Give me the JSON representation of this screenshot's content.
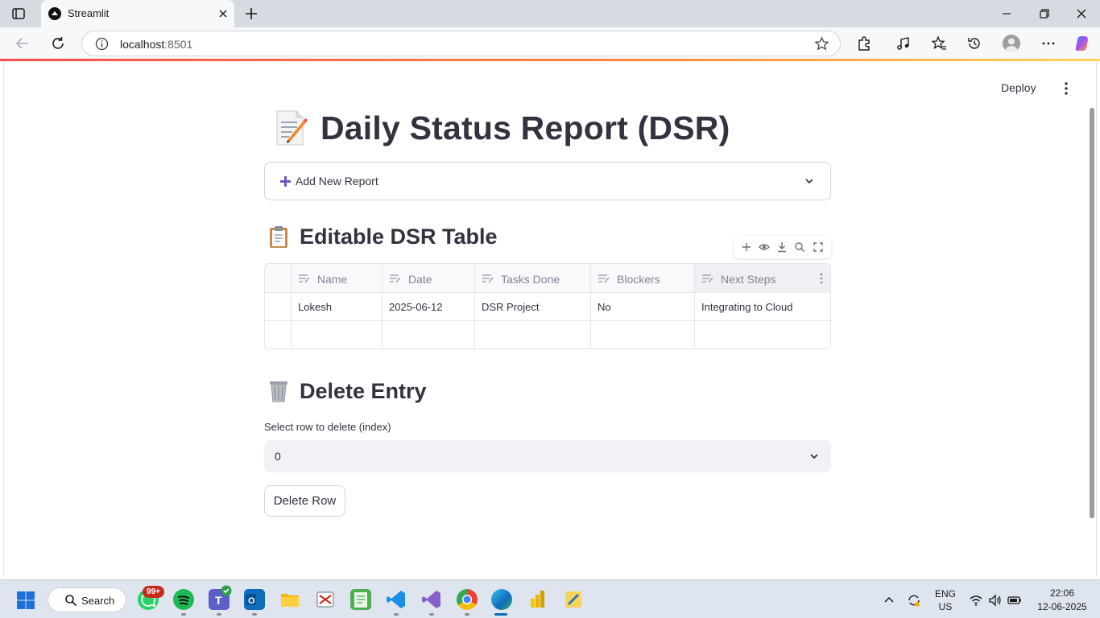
{
  "browser": {
    "tab_title": "Streamlit",
    "url_host": "localhost",
    "url_port": ":8501"
  },
  "app": {
    "deploy_label": "Deploy",
    "title": "Daily Status Report (DSR)",
    "title_emoji": "memo-icon",
    "expander_label": "Add New Report",
    "table_heading": "Editable DSR Table",
    "table_heading_emoji": "clipboard-icon",
    "table": {
      "columns": [
        "Name",
        "Date",
        "Tasks Done",
        "Blockers",
        "Next Steps"
      ],
      "rows": [
        [
          "Lokesh",
          "2025-06-12",
          "DSR Project",
          "No",
          "Integrating to Cloud"
        ],
        [
          "",
          "",
          "",
          "",
          ""
        ]
      ]
    },
    "delete_heading": "Delete Entry",
    "delete_heading_emoji": "wastebasket-icon",
    "select_label": "Select row to delete (index)",
    "select_value": "0",
    "delete_button": "Delete Row"
  },
  "taskbar": {
    "search_label": "Search",
    "whatsapp_badge": "99+",
    "lang_line1": "ENG",
    "lang_line2": "US",
    "time": "22:06",
    "date": "12-06-2025"
  },
  "colors": {
    "accent": "#ff4b4b",
    "text": "#31333f",
    "plus_icon": "#6a5acd"
  }
}
